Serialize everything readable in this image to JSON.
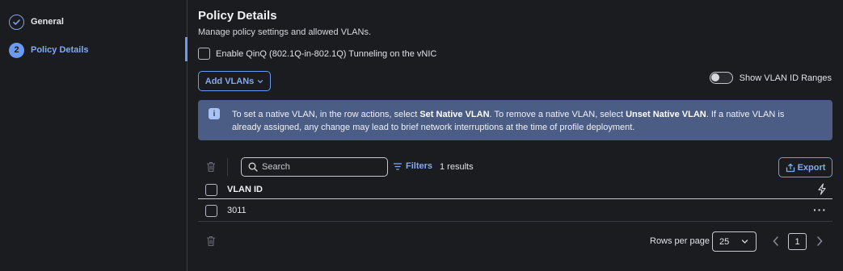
{
  "sidebar": {
    "steps": [
      {
        "number": "✓",
        "label": "General",
        "state": "completed"
      },
      {
        "number": "2",
        "label": "Policy Details",
        "state": "active"
      }
    ]
  },
  "main": {
    "title": "Policy Details",
    "subtitle": "Manage policy settings and allowed VLANs.",
    "qinq_label": "Enable QinQ (802.1Q-in-802.1Q) Tunneling on the vNIC",
    "add_vlans_label": "Add VLANs",
    "toggle_label": "Show VLAN ID Ranges",
    "info": {
      "part1": "To set a native VLAN, in the row actions, select ",
      "bold1": "Set Native VLAN",
      "part2": ". To remove a native VLAN, select ",
      "bold2": "Unset Native VLAN",
      "part3": ". If a native VLAN is already assigned, any change may lead to brief network interruptions at the time of profile deployment."
    }
  },
  "toolbar": {
    "search_placeholder": "Search",
    "filters_label": "Filters",
    "results_count": "1 results",
    "export_label": "Export"
  },
  "table": {
    "columns": [
      "VLAN ID"
    ],
    "rows": [
      {
        "vlan_id": "3011"
      }
    ]
  },
  "pagination": {
    "rows_per_page_label": "Rows per page",
    "rows_per_page_value": "25",
    "current_page": "1"
  },
  "colors": {
    "accent": "#6b9af0",
    "background": "#1b1c20",
    "info_banner": "#4b5c85"
  }
}
